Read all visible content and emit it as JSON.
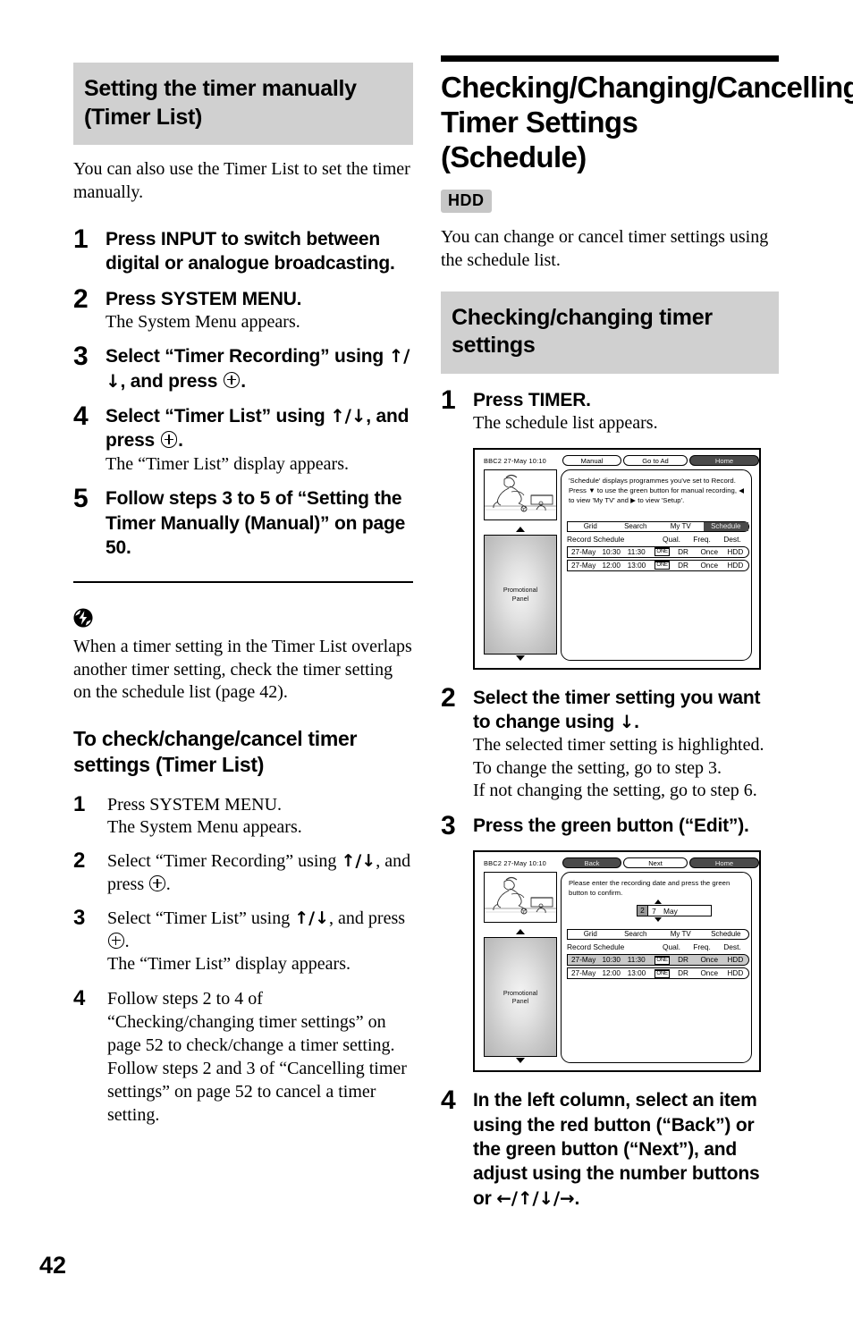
{
  "page": {
    "number": "42"
  },
  "left_column": {
    "heading": "Setting the timer manually (Timer List)",
    "intro": "You can also use the Timer List to set the timer manually.",
    "steps": [
      {
        "num": "1",
        "title": "Press INPUT to switch between digital or analogue broadcasting.",
        "note": ""
      },
      {
        "num": "2",
        "title": "Press SYSTEM MENU.",
        "note": "The System Menu appears."
      },
      {
        "num": "3",
        "title_pre": "Select “Timer Recording” using ",
        "title_mid": ", and press ",
        "title_post": ".",
        "arrows": "↑/↓",
        "note": ""
      },
      {
        "num": "4",
        "title_pre": "Select “Timer List” using ",
        "title_mid": ", and press ",
        "title_post": ".",
        "arrows": "↑/↓",
        "note": "The “Timer List” display appears."
      },
      {
        "num": "5",
        "title": "Follow steps 3 to 5 of “Setting the Timer Manually (Manual)” on page 50.",
        "note": ""
      }
    ],
    "note_icon": "note-bolt-icon",
    "note_text": "When a timer setting in the Timer List overlaps another timer setting, check the timer setting on the schedule list (page 42).",
    "subheading": "To check/change/cancel timer settings (Timer List)",
    "sub_steps": [
      {
        "num": "1",
        "title": "Press SYSTEM MENU.",
        "note": "The System Menu appears."
      },
      {
        "num": "2",
        "title_pre": "Select “Timer Recording” using ",
        "title_mid": ", and press ",
        "title_post": ".",
        "arrows": "↑/↓",
        "note": ""
      },
      {
        "num": "3",
        "title_pre": "Select “Timer List” using ",
        "title_mid": ", and press ",
        "title_post": ".",
        "arrows": "↑/↓",
        "note": "The “Timer List” display appears."
      },
      {
        "num": "4",
        "title": "Follow steps 2 to 4 of “Checking/changing timer settings” on page 52 to check/change a timer setting.\nFollow steps 2 and 3 of “Cancelling timer settings” on page 52 to cancel a timer setting.",
        "note": ""
      }
    ]
  },
  "right_column": {
    "heading": "Checking/Changing/Cancelling Timer Settings (Schedule)",
    "badge": "HDD",
    "intro": "You can change or cancel timer settings using the schedule list.",
    "subheading": "Checking/changing timer settings",
    "step1": {
      "num": "1",
      "title": "Press TIMER.",
      "note": "The schedule list appears."
    },
    "step2": {
      "num": "2",
      "title_pre": "Select the timer setting you want to change using ",
      "title_post": ".",
      "arrow": "↓",
      "notes": [
        "The selected timer setting is highlighted.",
        "To change the setting, go to step 3.",
        "If not changing the setting, go to step 6."
      ]
    },
    "step3": {
      "num": "3",
      "title": "Press the green button (“Edit”)."
    },
    "step4": {
      "num": "4",
      "title_pre": "In the left column, select an item using the red button (“Back”) or the green button (“Next”), and adjust using the number buttons or ",
      "arrows": "←/↑/↓/→",
      "title_post": "."
    }
  },
  "figure1": {
    "status": "BBC2   27-May   10:10",
    "buttons": [
      {
        "label": "Manual",
        "active": false
      },
      {
        "label": "Go to Ad",
        "active": false
      },
      {
        "label": "Home",
        "active": true
      }
    ],
    "description": "'Schedule' displays programmes you've set to Record. Press ▼ to use the green button for manual recording, ◀ to view 'My TV' and ▶ to view 'Setup'.",
    "promo_label": "Promotional\nPanel",
    "tabs": [
      {
        "label": "Grid",
        "active": false
      },
      {
        "label": "Search",
        "active": false
      },
      {
        "label": "My TV",
        "active": false
      },
      {
        "label": "Schedule",
        "active": true
      }
    ],
    "table_title": "Record Schedule",
    "columns": [
      "Qual.",
      "Freq.",
      "Dest."
    ],
    "rows": [
      {
        "date": "27-May",
        "start": "10:30",
        "end": "11:30",
        "logo": "ONE",
        "qual": "DR",
        "freq": "Once",
        "dest": "HDD",
        "selected": false
      },
      {
        "date": "27-May",
        "start": "12:00",
        "end": "13:00",
        "logo": "ONE",
        "qual": "DR",
        "freq": "Once",
        "dest": "HDD",
        "selected": false
      }
    ]
  },
  "figure2": {
    "status": "BBC2   27-May   10:10",
    "buttons": [
      {
        "label": "Back",
        "active": true
      },
      {
        "label": "Next",
        "active": false
      },
      {
        "label": "Home",
        "active": true
      }
    ],
    "description": "Please enter the recording date and press the green button to confirm.",
    "date_editor": {
      "digit1": "2",
      "digit2": "7",
      "month": "May"
    },
    "promo_label": "Promotional\nPanel",
    "tabs": [
      {
        "label": "Grid",
        "active": false
      },
      {
        "label": "Search",
        "active": false
      },
      {
        "label": "My TV",
        "active": false
      },
      {
        "label": "Schedule",
        "active": false
      }
    ],
    "table_title": "Record Schedule",
    "columns": [
      "Qual.",
      "Freq.",
      "Dest."
    ],
    "rows": [
      {
        "date": "27-May",
        "start": "10:30",
        "end": "11:30",
        "logo": "ONE",
        "qual": "DR",
        "freq": "Once",
        "dest": "HDD",
        "selected": true
      },
      {
        "date": "27-May",
        "start": "12:00",
        "end": "13:00",
        "logo": "ONE",
        "qual": "DR",
        "freq": "Once",
        "dest": "HDD",
        "selected": false
      }
    ]
  }
}
